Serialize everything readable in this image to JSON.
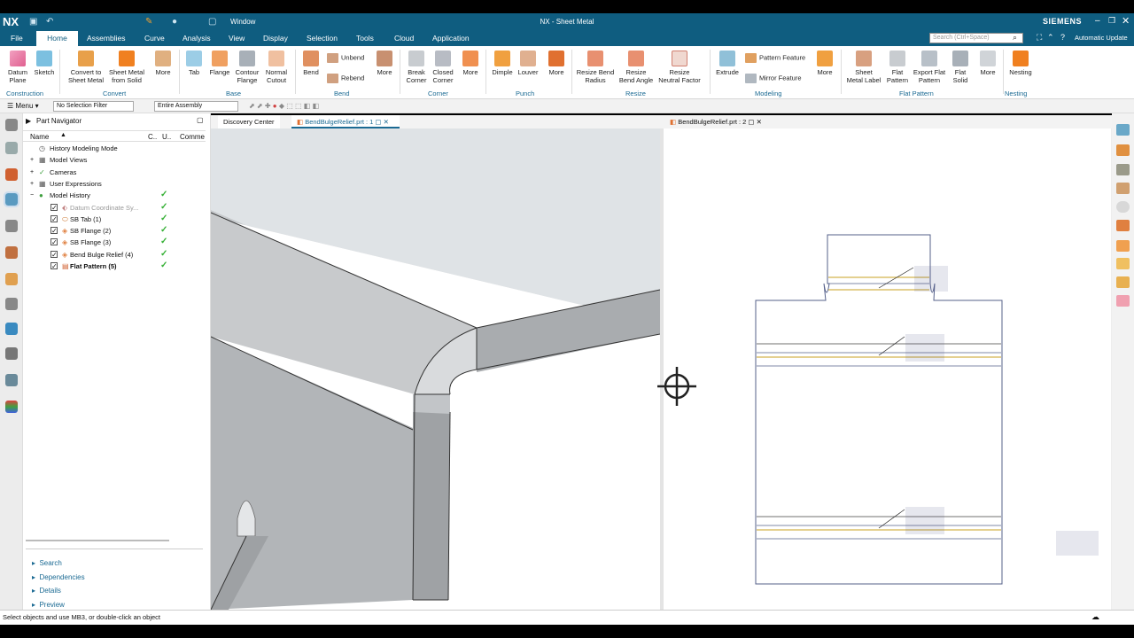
{
  "app": {
    "logo": "NX",
    "title": "NX - Sheet Metal",
    "brand": "SIEMENS",
    "window_menu": "Window",
    "update_label": "Automatic Update"
  },
  "colors": {
    "titlebar": "#0f5d80",
    "accent": "#1b6a93",
    "check": "#35b035"
  },
  "menu_tabs": [
    "File",
    "Home",
    "Assemblies",
    "Curve",
    "Analysis",
    "View",
    "Display",
    "Selection",
    "Tools",
    "Cloud",
    "Application"
  ],
  "search": {
    "placeholder": "Search (Ctrl+Space)"
  },
  "ribbon": {
    "buttons": [
      {
        "label": "Datum\nPlane",
        "icon": "datum-plane-icon"
      },
      {
        "label": "Sketch",
        "icon": "sketch-icon"
      },
      {
        "label": "Convert to\nSheet Metal",
        "icon": "convert-icon"
      },
      {
        "label": "Sheet Metal\nfrom Solid",
        "icon": "sheet-metal-from-solid-icon"
      },
      {
        "label": "More",
        "icon": "more-icon"
      },
      {
        "label": "Tab",
        "icon": "tab-icon"
      },
      {
        "label": "Flange",
        "icon": "flange-icon"
      },
      {
        "label": "Contour\nFlange",
        "icon": "contour-flange-icon"
      },
      {
        "label": "Normal\nCutout",
        "icon": "normal-cutout-icon"
      },
      {
        "label": "Bend",
        "icon": "bend-icon"
      },
      {
        "label": "More",
        "icon": "more-icon"
      },
      {
        "label": "Break\nCorner",
        "icon": "break-corner-icon"
      },
      {
        "label": "Closed\nCorner",
        "icon": "closed-corner-icon"
      },
      {
        "label": "More",
        "icon": "more-icon"
      },
      {
        "label": "Dimple",
        "icon": "dimple-icon"
      },
      {
        "label": "Louver",
        "icon": "louver-icon"
      },
      {
        "label": "More",
        "icon": "more-icon"
      },
      {
        "label": "Resize Bend\nRadius",
        "icon": "resize-bend-radius-icon"
      },
      {
        "label": "Resize\nBend Angle",
        "icon": "resize-bend-angle-icon"
      },
      {
        "label": "Resize\nNeutral Factor",
        "icon": "resize-neutral-factor-icon"
      },
      {
        "label": "Extrude",
        "icon": "extrude-icon"
      },
      {
        "label": "More",
        "icon": "more-icon"
      },
      {
        "label": "Sheet\nMetal Label",
        "icon": "sheet-metal-label-icon"
      },
      {
        "label": "Flat\nPattern",
        "icon": "flat-pattern-icon"
      },
      {
        "label": "Export Flat\nPattern",
        "icon": "export-flat-pattern-icon"
      },
      {
        "label": "Flat\nSolid",
        "icon": "flat-solid-icon"
      },
      {
        "label": "More",
        "icon": "more-icon"
      },
      {
        "label": "Nesting",
        "icon": "nesting-icon"
      }
    ],
    "small": {
      "unbend": "Unbend",
      "rebend": "Rebend",
      "pattern_feature": "Pattern Feature",
      "mirror_feature": "Mirror Feature"
    },
    "groups": [
      "Construction",
      "Convert",
      "Base",
      "Bend",
      "Corner",
      "Punch",
      "Resize",
      "Modeling",
      "Flat Pattern",
      "Nesting"
    ]
  },
  "selection_bar": {
    "menu": "Menu",
    "filter": "No Selection Filter",
    "scope": "Entire Assembly"
  },
  "navigator": {
    "title": "Part Navigator",
    "columns": [
      "Name",
      "C..",
      "U..",
      "Comme"
    ],
    "rows": [
      {
        "label": "History Modeling Mode",
        "ok": false
      },
      {
        "label": "Model Views",
        "ok": false
      },
      {
        "label": "Cameras",
        "ok": false
      },
      {
        "label": "User Expressions",
        "ok": false
      },
      {
        "label": "Model History",
        "ok": true
      },
      {
        "label": "Datum Coordinate Sy...",
        "ok": true
      },
      {
        "label": "SB Tab (1)",
        "ok": true
      },
      {
        "label": "SB Flange (2)",
        "ok": true
      },
      {
        "label": "SB Flange (3)",
        "ok": true
      },
      {
        "label": "Bend Bulge Relief (4)",
        "ok": true
      },
      {
        "label": "Flat Pattern (5)",
        "ok": true
      }
    ],
    "panels": [
      "Search",
      "Dependencies",
      "Details",
      "Preview"
    ]
  },
  "doc_tabs": {
    "discovery": "Discovery Center",
    "tab1": "BendBulgeRelief.prt : 1",
    "tab2": "BendBulgeRelief.prt : 2"
  },
  "status": {
    "message": "Select objects and use MB3, or double-click an object"
  }
}
